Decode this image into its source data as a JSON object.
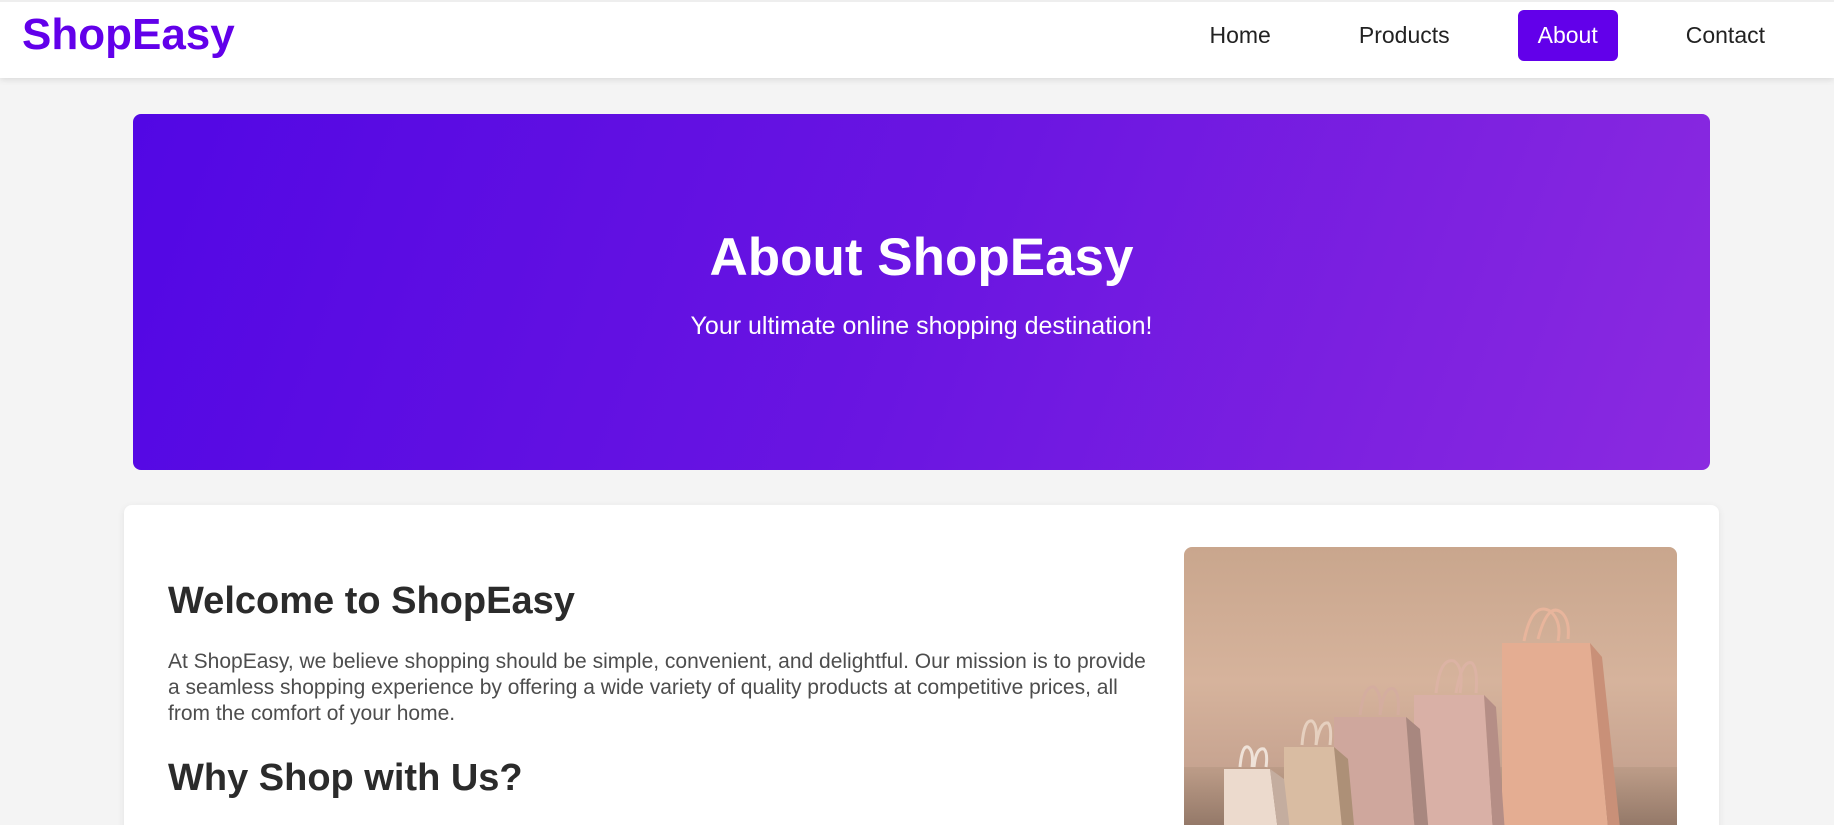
{
  "brand": {
    "name": "ShopEasy",
    "color": "#6200ea"
  },
  "nav": {
    "items": [
      {
        "label": "Home",
        "active": false
      },
      {
        "label": "Products",
        "active": false
      },
      {
        "label": "About",
        "active": true
      },
      {
        "label": "Contact",
        "active": false
      }
    ]
  },
  "hero": {
    "title": "About ShopEasy",
    "subtitle": "Your ultimate online shopping destination!",
    "gradient": [
      "#5207e4",
      "#8b2ae0"
    ]
  },
  "content": {
    "welcome_heading": "Welcome to ShopEasy",
    "welcome_text": "At ShopEasy, we believe shopping should be simple, convenient, and delightful. Our mission is to provide a seamless shopping experience by offering a wide variety of quality products at competitive prices, all from the comfort of your home.",
    "why_heading": "Why Shop with Us?",
    "image_subject": "shopping-bags-image"
  }
}
